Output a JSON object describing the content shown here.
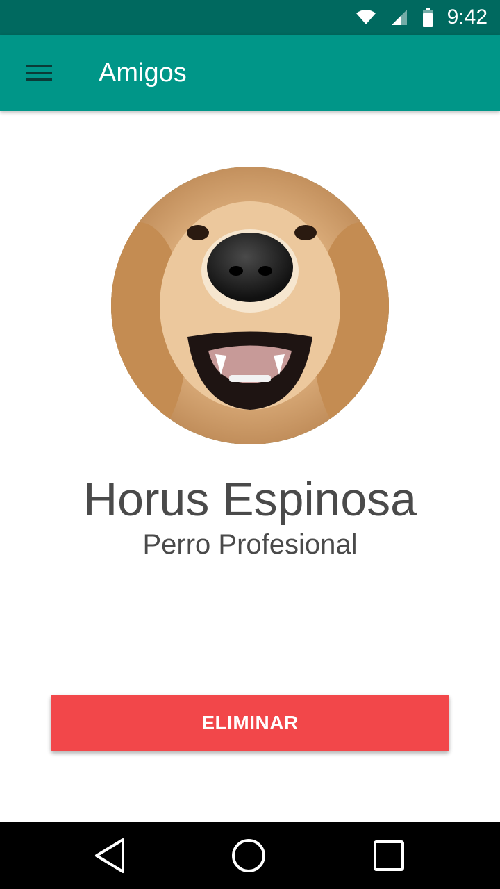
{
  "status_bar": {
    "time": "9:42",
    "icons": [
      "wifi-icon",
      "cell-signal-icon",
      "battery-icon"
    ]
  },
  "app_bar": {
    "title": "Amigos",
    "menu_icon": "hamburger-menu-icon",
    "color": "#009688"
  },
  "profile": {
    "avatar": "golden-retriever-photo",
    "name": "Horus Espinosa",
    "subtitle": "Perro Profesional"
  },
  "actions": {
    "delete_label": "ELIMINAR",
    "delete_color": "#f2474a"
  },
  "nav_bar": {
    "icons": [
      "back-icon",
      "home-icon",
      "recents-icon"
    ]
  }
}
